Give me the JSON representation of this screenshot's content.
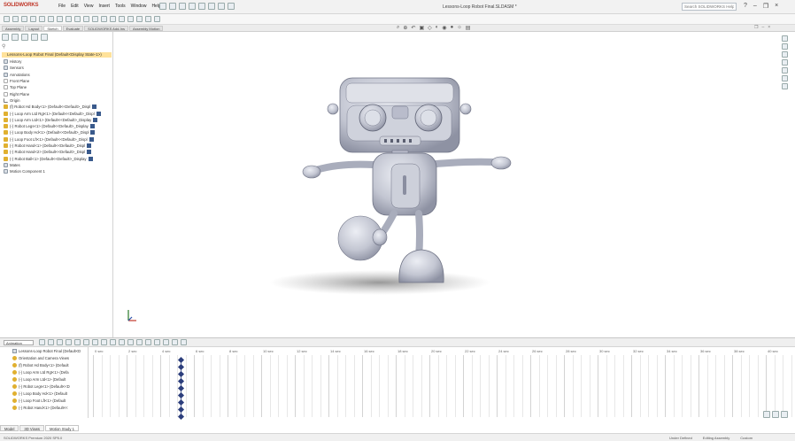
{
  "app": {
    "brand": "SOLIDWORKS",
    "window_title": "Lessons-Loop Robot Final.SLDASM *",
    "search_placeholder": "Search SOLIDWORKS Help",
    "window_controls": [
      "?",
      "–",
      "❐",
      "×"
    ]
  },
  "menu": [
    "File",
    "Edit",
    "View",
    "Insert",
    "Tools",
    "Window",
    "Help"
  ],
  "command_tabs": [
    "Assembly",
    "Layout",
    "Sketch",
    "Evaluate",
    "SOLIDWORKS Add-Ins",
    "Assembly Motion"
  ],
  "active_tab_index": 2,
  "feature_tree": {
    "root": "Lessons-Loop Robot Final (Default<Display State-1>)",
    "items": [
      {
        "label": "History",
        "icon": "doc"
      },
      {
        "label": "Sensors",
        "icon": "doc"
      },
      {
        "label": "Annotations",
        "icon": "doc"
      },
      {
        "label": "Front Plane",
        "icon": "plane"
      },
      {
        "label": "Top Plane",
        "icon": "plane"
      },
      {
        "label": "Right Plane",
        "icon": "plane"
      },
      {
        "label": "Origin",
        "icon": "origin"
      },
      {
        "label": "(f) Robot Hd Body<1> (Default<<Default>_Displ",
        "icon": "gold"
      },
      {
        "label": "(-) Loop Arm Ltd Rgt<1> (Default<<Default>_Displ",
        "icon": "gold"
      },
      {
        "label": "(-) Loop Arm Ltd<1> (Default<<Default>_Display",
        "icon": "gold"
      },
      {
        "label": "(-) Robot Legs<1> (Default<<Default>_Display",
        "icon": "gold"
      },
      {
        "label": "(-) Loop Body Hd<1> (Default<<Default>_Displ",
        "icon": "gold"
      },
      {
        "label": "(-) Loop Foot Lft<1> (Default<<Default>_Displ",
        "icon": "gold"
      },
      {
        "label": "(-) Robot Hand<1> (Default<<Default>_Displ",
        "icon": "gold"
      },
      {
        "label": "(-) Robot Hand<2> (Default<<Default>_Displ",
        "icon": "gold"
      },
      {
        "label": "(-) Robot Ball<1> (Default<<Default>_Display",
        "icon": "gold"
      },
      {
        "label": "Mates",
        "icon": "doc"
      },
      {
        "label": "Motion Component 1",
        "icon": "doc"
      }
    ]
  },
  "motion_manager": {
    "study_type": "Animation",
    "tree": [
      "Lessons-Loop Robot Final (Default<D",
      "Orientation and Camera Views",
      "(f) Robot Hd Body<1> (Default",
      "(-) Loop Arm Ltd Rgt<1> (Defa",
      "(-) Loop Arm Ltd<1> (Default",
      "(-) Robot Legs<1> (Default<<D",
      "(-) Loop Body Hd<1> (Default",
      "(-) Loop Foot Lft<1> (Default",
      "(-) Robot Hand<1> (Default<<"
    ],
    "time_labels": [
      "0 sec",
      "2 sec",
      "4 sec",
      "6 sec",
      "8 sec",
      "10 sec",
      "12 sec",
      "14 sec",
      "16 sec",
      "18 sec",
      "20 sec",
      "22 sec",
      "24 sec",
      "26 sec",
      "28 sec",
      "30 sec",
      "32 sec",
      "34 sec",
      "36 sec",
      "38 sec",
      "40 sec"
    ],
    "tabs": [
      "Model",
      "3D Views",
      "Motion Study 1"
    ],
    "active_tab_index": 2
  },
  "status": {
    "left": "SOLIDWORKS Premium 2020 SP5.0",
    "right": [
      "Under Defined",
      "Editing Assembly",
      "Custom"
    ]
  },
  "colors": {
    "selection": "#ffe29a",
    "brand": "#c0392b",
    "keyframe": "#2c3e7c",
    "model": "#c9cbd6"
  }
}
